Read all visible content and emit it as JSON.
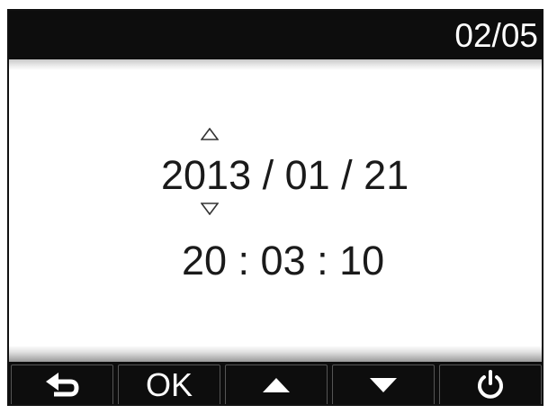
{
  "header": {
    "page_indicator": "02/05"
  },
  "datetime": {
    "date": "2013 / 01 / 21",
    "time": "20 : 03 : 10"
  },
  "icons": {
    "increase": "triangle-up-outline-icon",
    "decrease": "triangle-down-outline-icon"
  },
  "buttons": {
    "back_icon": "back-arrow-icon",
    "ok_label": "OK",
    "up_icon": "triangle-up-icon",
    "down_icon": "triangle-down-icon",
    "power_icon": "power-icon"
  },
  "colors": {
    "bar_background": "#0d0d0d",
    "screen_background": "#ffffff",
    "text": "#1a1a1a",
    "button_text": "#ffffff"
  }
}
